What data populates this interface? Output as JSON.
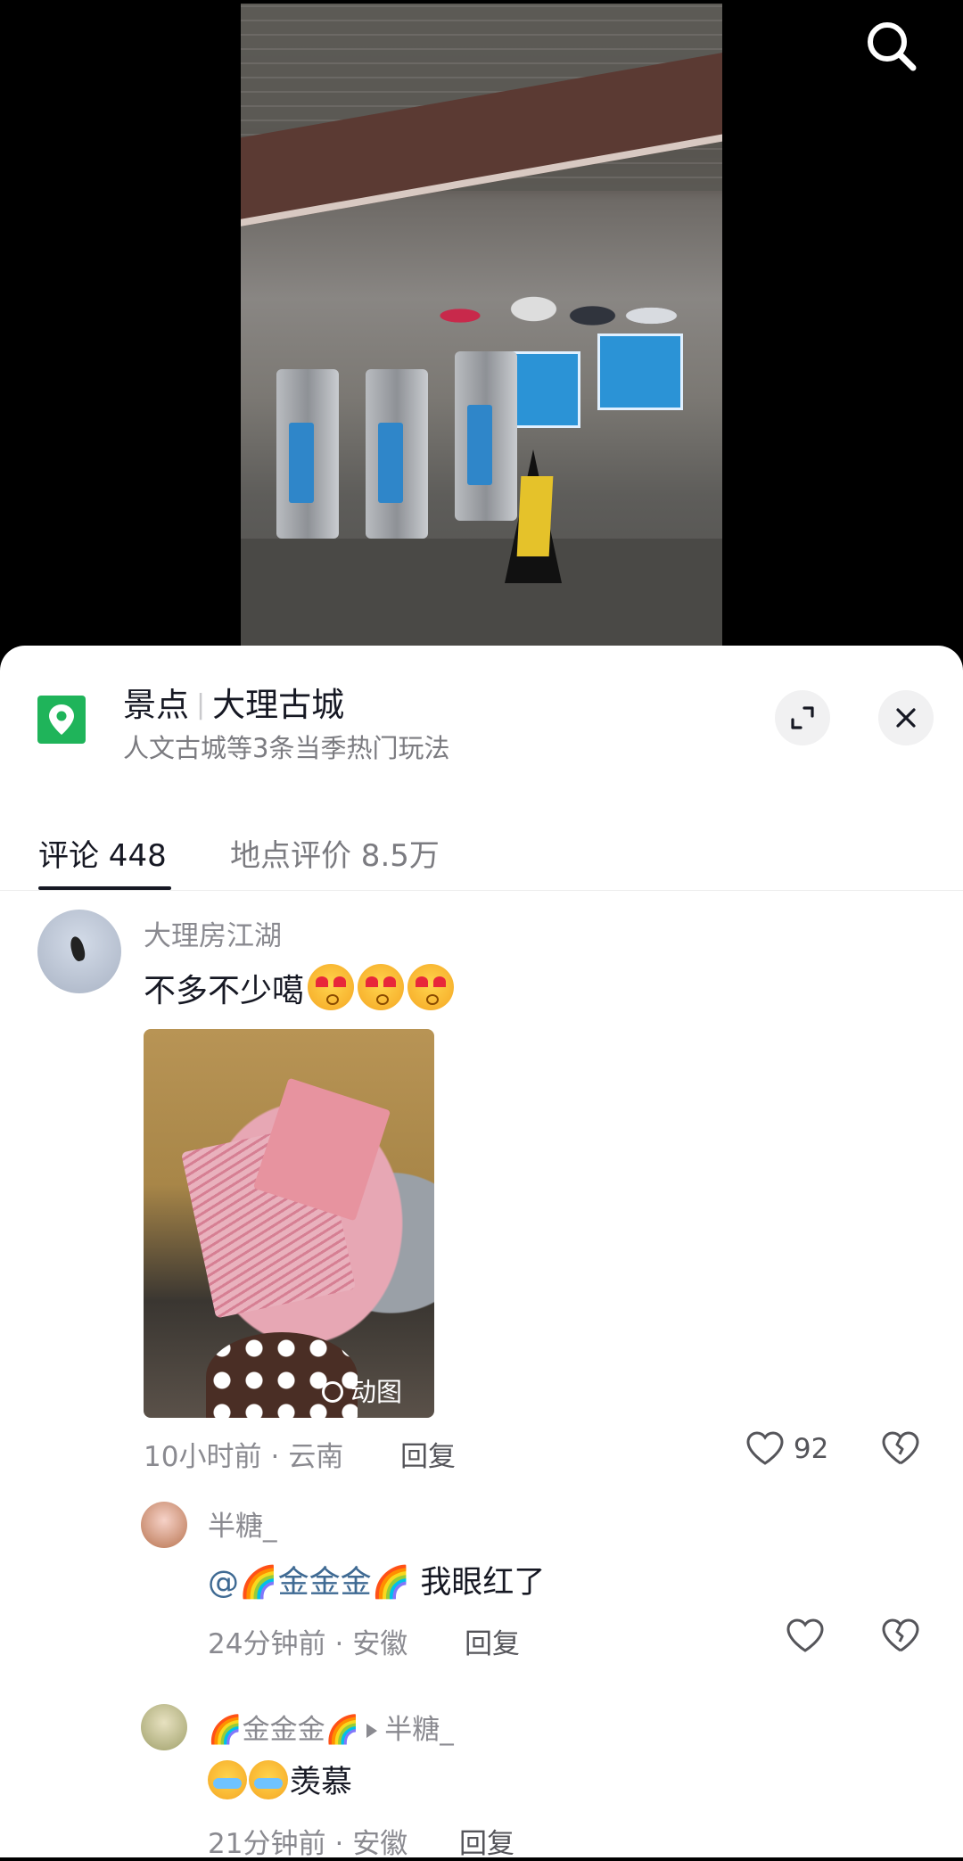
{
  "location": {
    "category": "景点",
    "name": "大理古城",
    "subtitle": "人文古城等3条当季热门玩法"
  },
  "tabs": [
    {
      "label": "评论 448",
      "active": true
    },
    {
      "label": "地点评价 8.5万",
      "active": false
    }
  ],
  "comments": [
    {
      "user": "大理房江湖",
      "text": "不多不少噶",
      "emoji_count": 3,
      "media_label": "动图",
      "time": "10小时前",
      "region": "云南",
      "reply_label": "回复",
      "likes": "92"
    }
  ],
  "replies": [
    {
      "user": "半糖_",
      "mention": "@🌈金金金🌈",
      "text": "我眼红了",
      "time": "24分钟前",
      "region": "安徽",
      "reply_label": "回复"
    },
    {
      "user": "🌈金金金🌈",
      "reply_to": "半糖_",
      "text": "羡慕",
      "time": "21分钟前",
      "region": "安徽",
      "reply_label": "回复"
    }
  ],
  "meta_separator": "·",
  "icons": {
    "search": "search-icon",
    "location": "location-pin-icon",
    "expand": "expand-icon",
    "close": "close-icon",
    "like": "heart-icon",
    "dislike": "broken-heart-icon"
  },
  "colors": {
    "accent_green": "#1fb45a",
    "text_primary": "#161823",
    "text_secondary": "#8a8a90",
    "mention": "#3f6a93"
  }
}
